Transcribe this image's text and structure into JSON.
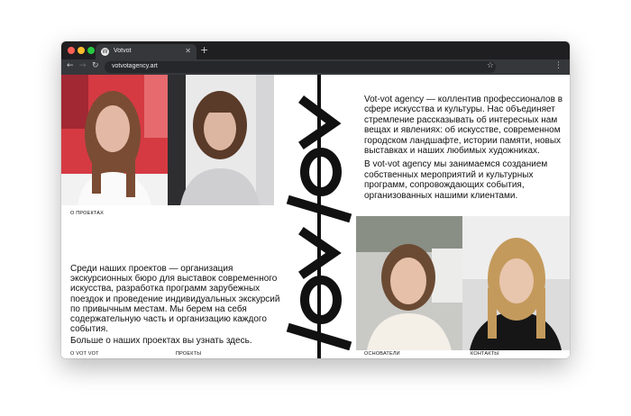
{
  "browser": {
    "tab_title": "Votvot",
    "favicon": "wordpress-icon",
    "url": "votvotagency.art"
  },
  "page": {
    "logo_text": "Votvot",
    "intro": [
      "Vot-vot agency — коллентив профессионалов в сфере искусства и культуры. Нас объединяет стремление рассказывать об интересных нам вещах и явлениях: об искусстве, современном городском ландшафте, истории памяти, новых выставках и наших любимых художниках.",
      "В vot-vot agency мы занимаемся созданием собственных мероприятий и культурных программ, сопровождающих события, организованных нашими клиентами."
    ],
    "projects_text": "Среди наших проектов — организация экскурсионных бюро для выставок современного искусства, разработка программ зарубежных поездок и проведение индивидуальных экскурсий по привычным местам. Мы берем на себя содержательную часть и организацию каждого события.",
    "projects_more": "Больше о наших проектах вы узнать здесь.",
    "captions": {
      "about_projects": "О ПРОЕКТАХ",
      "about": "О VOT VOT",
      "projects": "ПРОЕКТЫ",
      "founders": "ОСНОВАТЕЛИ",
      "contacts": "КОНТАКТЫ"
    }
  }
}
